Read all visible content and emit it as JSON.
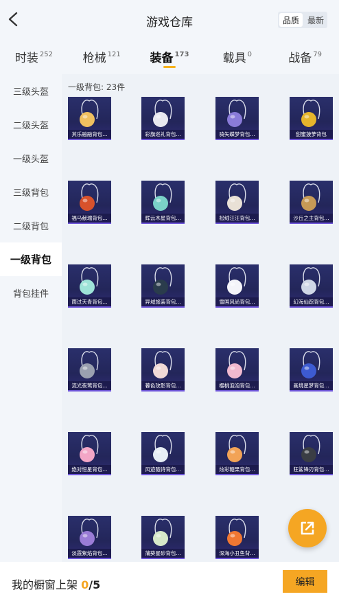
{
  "header": {
    "title": "游戏仓库",
    "sort_options": [
      "品质",
      "最新"
    ]
  },
  "tabs": [
    {
      "label": "时装",
      "count": "252"
    },
    {
      "label": "枪械",
      "count": "121"
    },
    {
      "label": "装备",
      "count": "173"
    },
    {
      "label": "载具",
      "count": "0"
    },
    {
      "label": "战备",
      "count": "79"
    }
  ],
  "sidebar": {
    "items": [
      {
        "label": "三级头盔"
      },
      {
        "label": "二级头盔"
      },
      {
        "label": "一级头盔"
      },
      {
        "label": "三级背包"
      },
      {
        "label": "二级背包"
      },
      {
        "label": "一级背包"
      },
      {
        "label": "背包挂件"
      }
    ]
  },
  "content": {
    "count_label": "一级背包: 23件",
    "items": [
      {
        "name": "其乐融融背包...",
        "icon": "cup-backpack-icon",
        "color": "#f0c060"
      },
      {
        "name": "彩旗巡礼背包...",
        "icon": "mascot-backpack-icon",
        "color": "#e8e8f0"
      },
      {
        "name": "骑矢蝶梦背包...",
        "icon": "crystal-backpack-icon",
        "color": "#8a7bd9"
      },
      {
        "name": "甜蜜菠萝背包",
        "icon": "pineapple-backpack-icon",
        "color": "#e6b52c"
      },
      {
        "name": "福马献瑞背包...",
        "icon": "horse-backpack-icon",
        "color": "#d8522c"
      },
      {
        "name": "辉云木星背包...",
        "icon": "planet-backpack-icon",
        "color": "#7ad1c8"
      },
      {
        "name": "松绒汪汪背包...",
        "icon": "poodle-backpack-icon",
        "color": "#e9e1d6"
      },
      {
        "name": "沙丘之主背包...",
        "icon": "scorpion-backpack-icon",
        "color": "#c79a56"
      },
      {
        "name": "雨过天青背包...",
        "icon": "jade-backpack-icon",
        "color": "#9ee3d8"
      },
      {
        "name": "异域旅装背包...",
        "icon": "traveler-backpack-icon",
        "color": "#2a3c4c"
      },
      {
        "name": "雪国风尚背包...",
        "icon": "bunny-backpack-icon",
        "color": "#f4f4f9"
      },
      {
        "name": "幻海仙踪背包...",
        "icon": "shell-backpack-icon",
        "color": "#cfd6e6"
      },
      {
        "name": "流光夜莺背包...",
        "icon": "bird-backpack-icon",
        "color": "#9aa0b0"
      },
      {
        "name": "暮色玫影背包...",
        "icon": "bat-backpack-icon",
        "color": "#f0d9d6"
      },
      {
        "name": "樱桃泡泡背包...",
        "icon": "bow-backpack-icon",
        "color": "#f1b9cf"
      },
      {
        "name": "画境星梦背包...",
        "icon": "frame-backpack-icon",
        "color": "#3d5bd1"
      },
      {
        "name": "绝对恒星背包...",
        "icon": "drink-backpack-icon",
        "color": "#f3a6c6"
      },
      {
        "name": "风迹随诗背包...",
        "icon": "shirt-backpack-icon",
        "color": "#e6eef5"
      },
      {
        "name": "炫彩糖果背包...",
        "icon": "donut-backpack-icon",
        "color": "#f2a356"
      },
      {
        "name": "狂鲨锋刃背包...",
        "icon": "shark-backpack-icon",
        "color": "#3a3d44"
      },
      {
        "name": "淡霞紫焰背包...",
        "icon": "flame-backpack-icon",
        "color": "#9a7cd6"
      },
      {
        "name": "蒲葵星砂背包...",
        "icon": "fan-backpack-icon",
        "color": "#d6e8c9"
      },
      {
        "name": "深海小丑鱼背...",
        "icon": "clownfish-backpack-icon",
        "color": "#f07732"
      }
    ]
  },
  "footer": {
    "label": "我的橱窗上架",
    "shown": "0",
    "total": "/5",
    "edit_label": "编辑"
  },
  "colors": {
    "accent": "#f5a623",
    "card_bg": "#23265a",
    "card_border": "#6e55d9"
  }
}
